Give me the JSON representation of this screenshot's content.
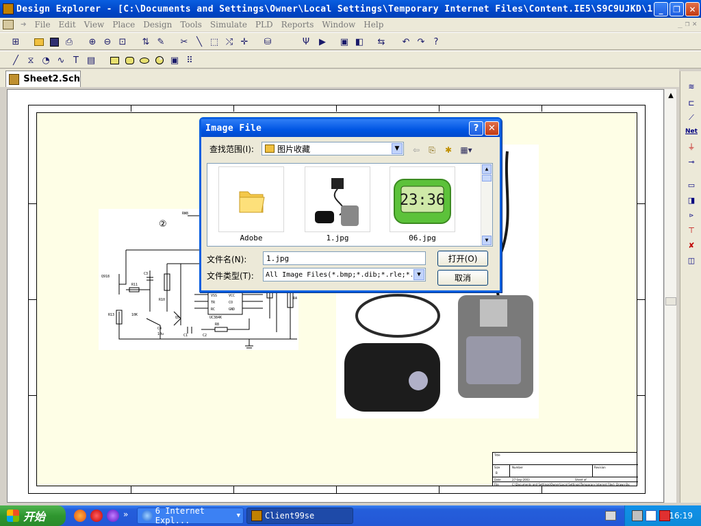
{
  "window": {
    "title": "Design Explorer - [C:\\Documents and Settings\\Owner\\Local Settings\\Temporary Internet Files\\Content.IE5\\S9C9UJKD\\1..."
  },
  "menu": [
    "File",
    "Edit",
    "View",
    "Place",
    "Design",
    "Tools",
    "Simulate",
    "PLD",
    "Reports",
    "Window",
    "Help"
  ],
  "tab": {
    "label": "Sheet2.Sch"
  },
  "schematic": {
    "title_block": {
      "title": "Title",
      "size": "Size",
      "size_value": "B",
      "number": "Number",
      "revision": "Revision",
      "date": "Date",
      "date_value": "27-Sep-2003",
      "sheet": "Sheet   of",
      "file": "File",
      "file_value": "C:\\Documents and Settings\\Owner\\Local Settings\\Temporary Internet Files\\Content.IE5\\S9C9UJKD\\1.SCH",
      "drawn_by": "Drawn By:"
    },
    "circuit": {
      "marker": "②",
      "labels": [
        "RW8",
        "SHI",
        "Q918",
        "R11",
        "C3",
        "R10",
        "Q5",
        "R13",
        "10K",
        "C4",
        "10u",
        "C1",
        "C2",
        "R8",
        "R4",
        "VSS",
        "TR",
        "RC",
        "VCC",
        "CO",
        "GND",
        "UC384K",
        "1",
        "2",
        "3",
        "4",
        "5",
        "6",
        "7",
        "8"
      ]
    }
  },
  "dialog": {
    "title": "Image File",
    "help_label": "?",
    "close_label": "✕",
    "look_in_label": "查找范围(I):",
    "look_in_value": "图片收藏",
    "files": [
      {
        "name": "Adobe",
        "type": "folder"
      },
      {
        "name": "1.jpg",
        "type": "image"
      },
      {
        "name": "06.jpg",
        "type": "image"
      }
    ],
    "clock_display": "23:36",
    "filename_label": "文件名(N):",
    "filename_value": "1.jpg",
    "filetype_label": "文件类型(T):",
    "filetype_value": "All Image Files(*.bmp;*.dib;*.rle;*.",
    "open_label": "打开(O)",
    "cancel_label": "取消"
  },
  "taskbar": {
    "start_label": "开始",
    "tasks": [
      {
        "label": "6 Internet Expl...",
        "active": false
      },
      {
        "label": "Client99se",
        "active": true
      }
    ],
    "clock": "16:19"
  },
  "palette": {
    "net_label": "Net"
  },
  "colors": {
    "titlebar": "#0a5fe0",
    "sheet_fill": "#fefee6",
    "taskbar": "#245edb",
    "start_green": "#3c9a3c",
    "clock_green": "#7ad03a"
  }
}
